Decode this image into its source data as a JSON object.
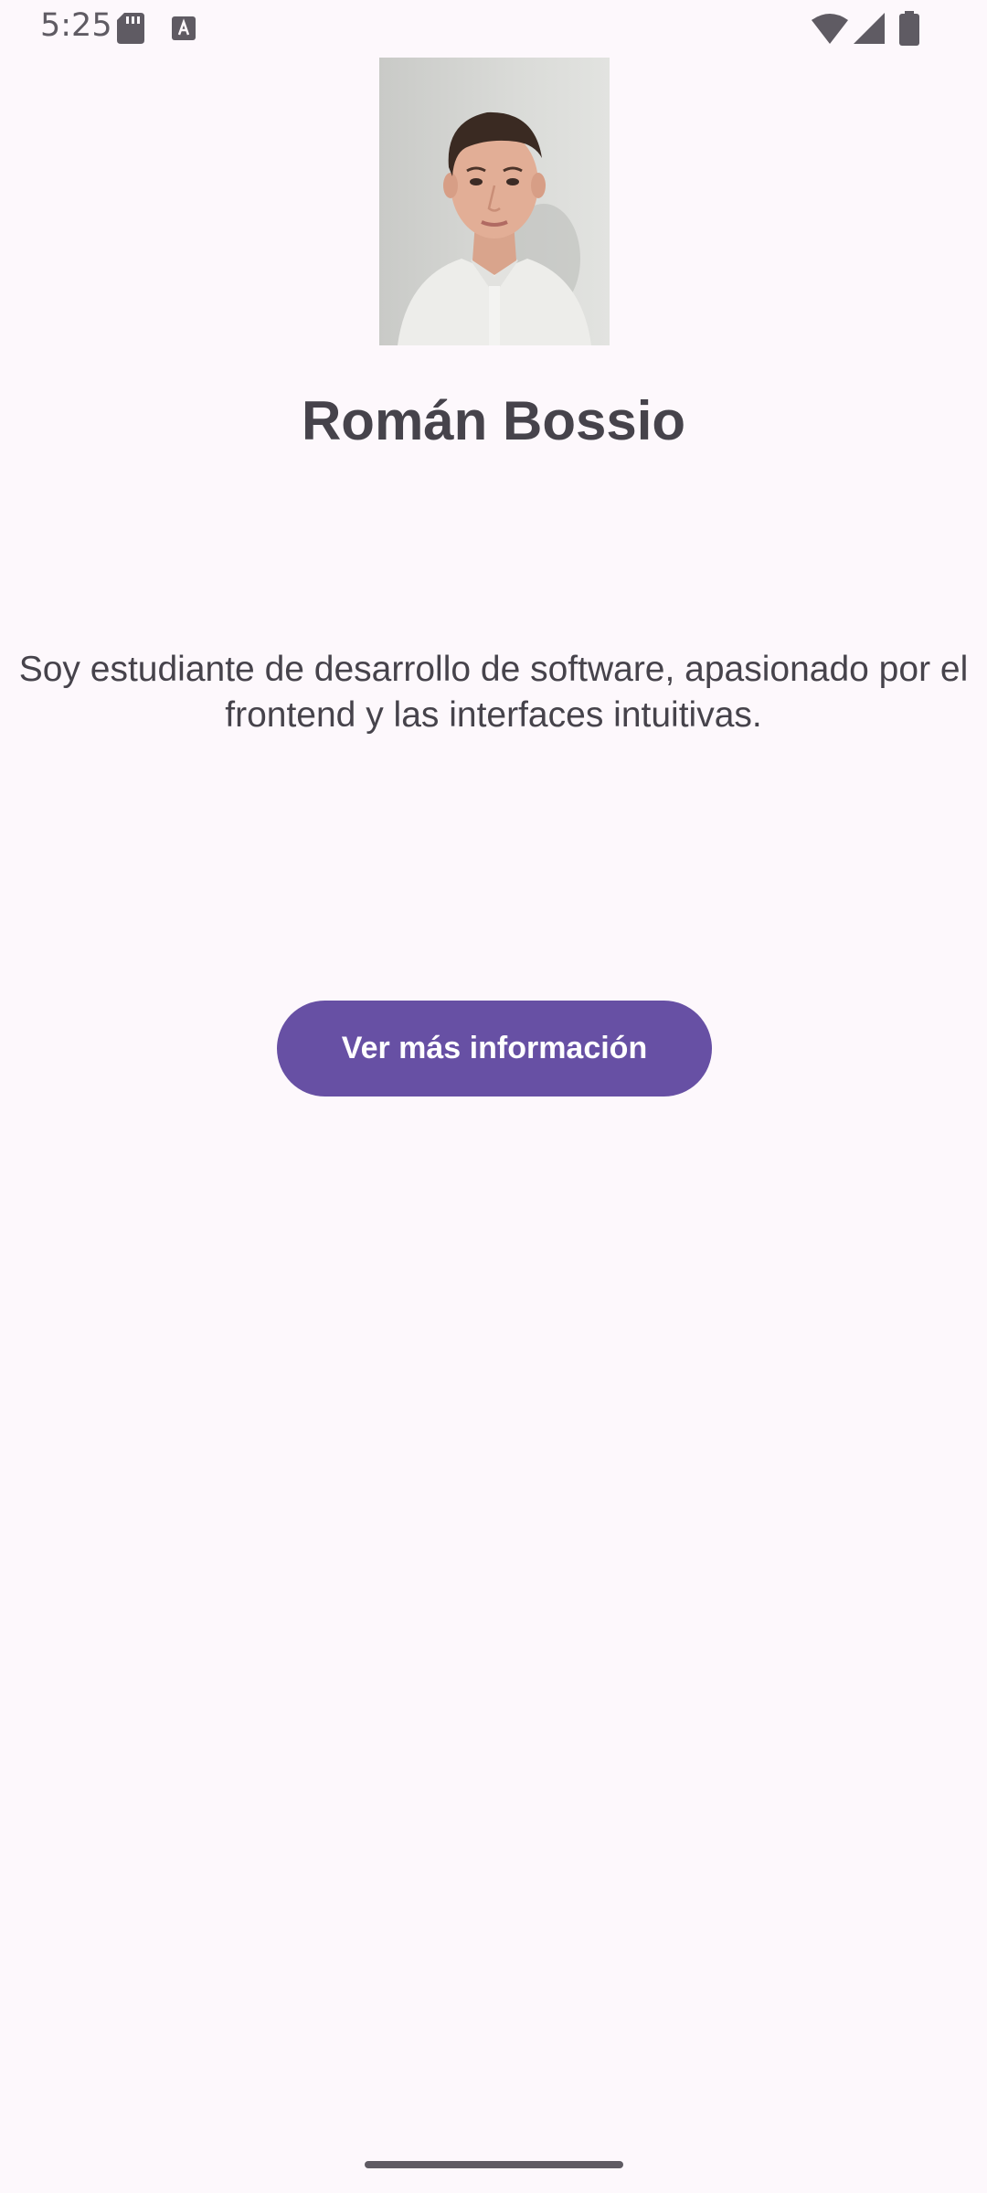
{
  "status_bar": {
    "time": "5:25",
    "icons": [
      "sd-card-icon",
      "text-input-icon",
      "wifi-icon",
      "cell-signal-icon",
      "battery-icon"
    ]
  },
  "profile": {
    "name": "Román Bossio",
    "bio": "Soy estudiante de desarrollo de software, apasionado por el frontend y las interfaces intuitivas.",
    "button_label": "Ver más información"
  },
  "colors": {
    "background": "#FDF8FC",
    "primary": "#6750A4",
    "text": "#46434B"
  }
}
